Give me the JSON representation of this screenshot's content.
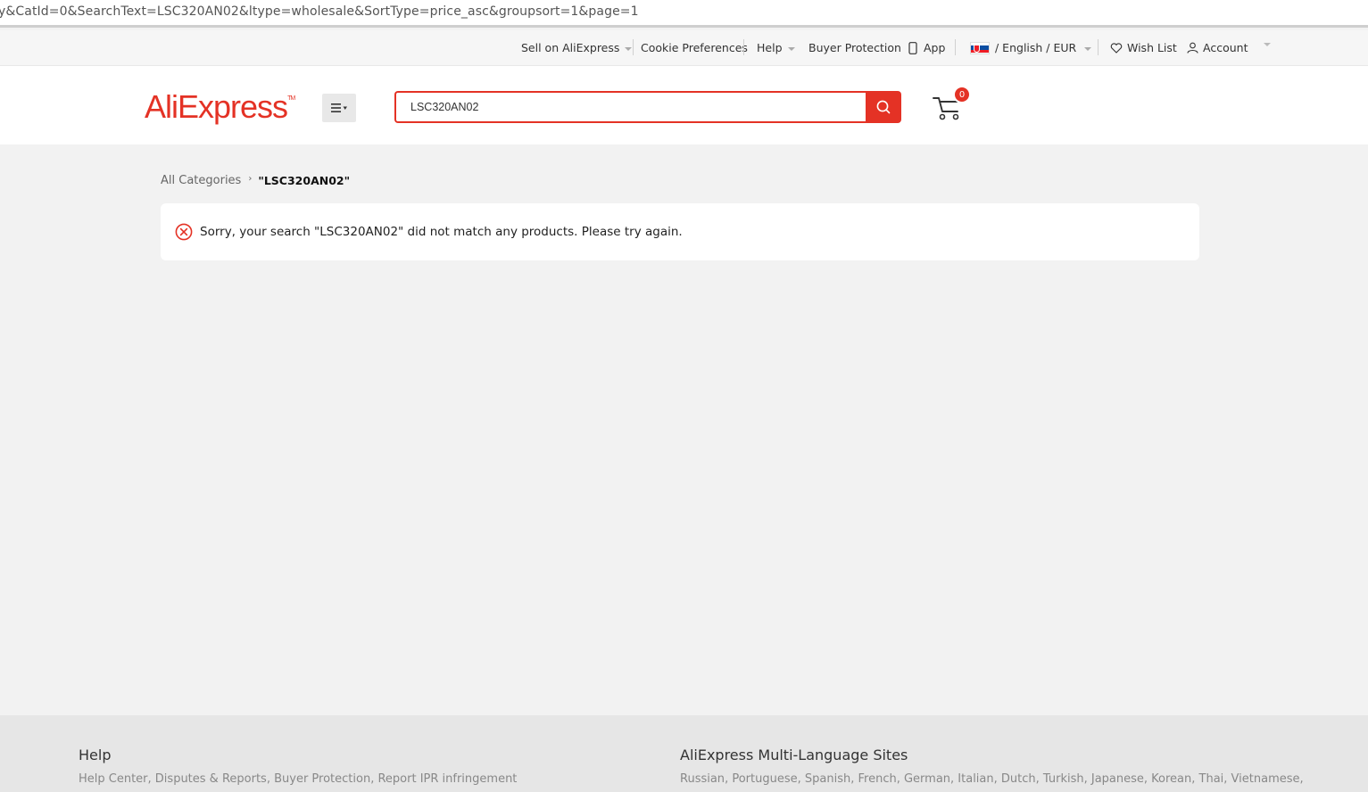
{
  "browser": {
    "url": "y&CatId=0&SearchText=LSC320AN02&ltype=wholesale&SortType=price_asc&groupsort=1&page=1"
  },
  "topbar": {
    "sell": "Sell on AliExpress",
    "cookie": "Cookie Preferences",
    "help": "Help",
    "buyer_protection": "Buyer Protection",
    "app": "App",
    "language_currency": "/ English /  EUR",
    "wish_list": "Wish List",
    "account": "Account"
  },
  "header": {
    "logo": "AliExpress",
    "search": {
      "value": "LSC320AN02"
    },
    "cart_count": "0"
  },
  "breadcrumb": {
    "root": "All Categories",
    "current": "\"LSC320AN02\""
  },
  "notice": {
    "message": "Sorry, your search \"LSC320AN02\" did not match any products. Please try again."
  },
  "footer": {
    "help_title": "Help",
    "help_links": [
      "Help Center",
      "Disputes & Reports",
      "Buyer Protection",
      "Report IPR infringement"
    ],
    "sites_title": "AliExpress Multi-Language Sites",
    "sites_links": [
      "Russian",
      "Portuguese",
      "Spanish",
      "French",
      "German",
      "Italian",
      "Dutch",
      "Turkish",
      "Japanese",
      "Korean",
      "Thai",
      "Vietnamese"
    ]
  },
  "colors": {
    "brand": "#e43225",
    "page_bg": "#f2f2f2"
  }
}
